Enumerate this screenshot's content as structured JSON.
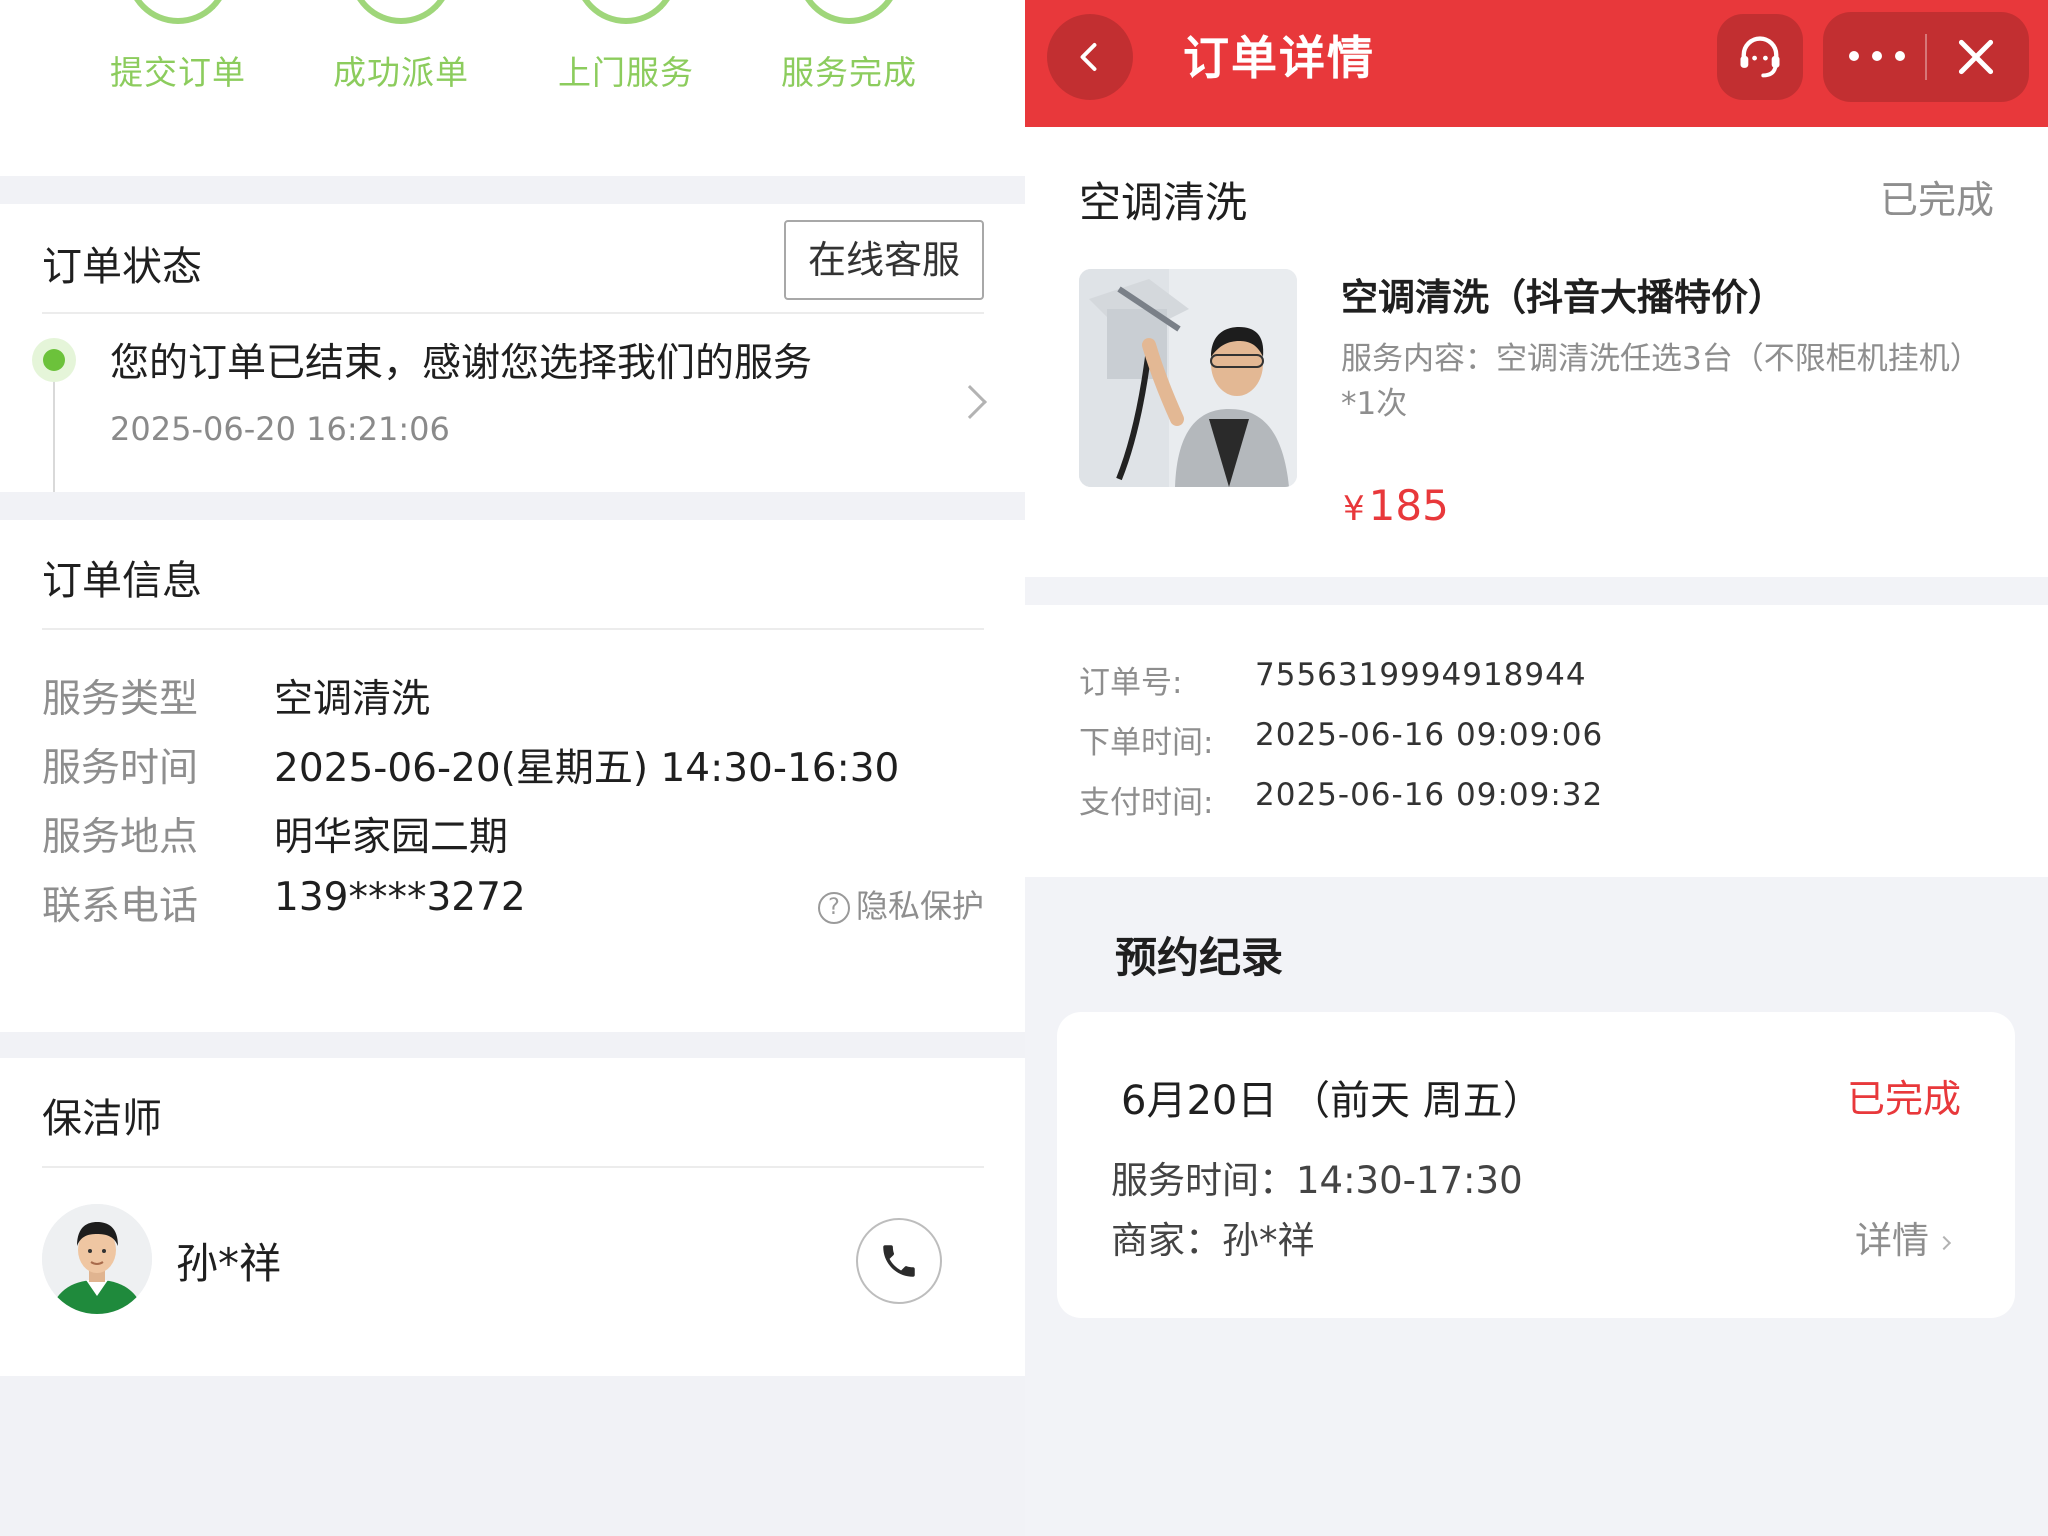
{
  "left": {
    "steps": [
      "提交订单",
      "成功派单",
      "上门服务",
      "服务完成"
    ],
    "status": {
      "title": "订单状态",
      "cs_button": "在线客服",
      "message": "您的订单已结束，感谢您选择我们的服务",
      "time": "2025-06-20 16:21:06"
    },
    "info": {
      "title": "订单信息",
      "rows": [
        {
          "key": "服务类型",
          "value": "空调清洗"
        },
        {
          "key": "服务时间",
          "value": "2025-06-20(星期五) 14:30-16:30"
        },
        {
          "key": "服务地点",
          "value": "明华家园二期"
        },
        {
          "key": "联系电话",
          "value": "139****3272"
        }
      ],
      "privacy": "隐私保护"
    },
    "cleaner": {
      "title": "保洁师",
      "name": "孙*祥"
    }
  },
  "right": {
    "nav_title": "订单详情",
    "product": {
      "category": "空调清洗",
      "status": "已完成",
      "title": "空调清洗（抖音大播特价）",
      "description": "服务内容：空调清洗任选3台（不限柜机挂机）*1次",
      "currency": "¥",
      "price": "185"
    },
    "order": [
      {
        "key": "订单号:",
        "value": "7556319994918944"
      },
      {
        "key": "下单时间:",
        "value": "2025-06-16 09:09:06"
      },
      {
        "key": "支付时间:",
        "value": "2025-06-16 09:09:32"
      }
    ],
    "record": {
      "title": "预约纪录",
      "date": "6月20日 （前天 周五）",
      "status": "已完成",
      "service_time": "服务时间：14:30-17:30",
      "merchant": "商家：孙*祥",
      "detail": "详情"
    }
  },
  "colors": {
    "accent_red": "#e8383b",
    "step_green": "#8ccc5d",
    "status_green": "#6cc23b"
  },
  "icons": [
    "back-icon",
    "customer-service-icon",
    "more-icon",
    "close-icon",
    "phone-icon",
    "question-icon",
    "chevron-right-icon"
  ]
}
